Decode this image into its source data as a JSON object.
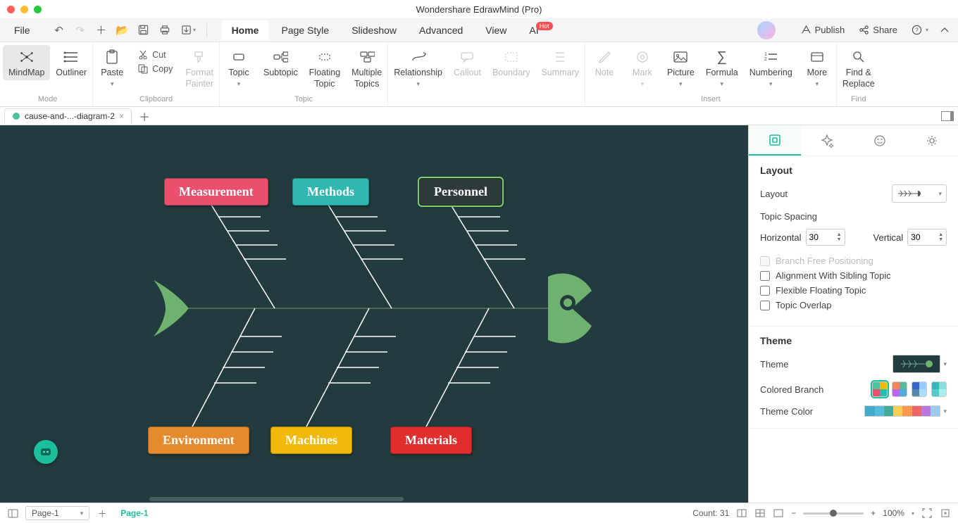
{
  "app_title": "Wondershare EdrawMind (Pro)",
  "menubar": {
    "file": "File",
    "tabs": [
      "Home",
      "Page Style",
      "Slideshow",
      "Advanced",
      "View",
      "AI"
    ],
    "active_tab": "Home",
    "hot": "Hot",
    "publish": "Publish",
    "share": "Share"
  },
  "ribbon": {
    "mode_label": "Mode",
    "mindmap": "MindMap",
    "outliner": "Outliner",
    "clipboard_label": "Clipboard",
    "paste": "Paste",
    "cut": "Cut",
    "copy": "Copy",
    "format_painter": "Format\nPainter",
    "topic_label": "Topic",
    "topic": "Topic",
    "subtopic": "Subtopic",
    "floating": "Floating\nTopic",
    "multiple": "Multiple\nTopics",
    "relationship": "Relationship",
    "callout": "Callout",
    "boundary": "Boundary",
    "summary": "Summary",
    "insert_label": "Insert",
    "note": "Note",
    "mark": "Mark",
    "picture": "Picture",
    "formula": "Formula",
    "numbering": "Numbering",
    "more": "More",
    "find_label": "Find",
    "find_replace": "Find &\nReplace"
  },
  "document": {
    "tab_name": "cause-and-...-diagram-2"
  },
  "fish": {
    "top": [
      "Measurement",
      "Methods",
      "Personnel"
    ],
    "bottom": [
      "Environment",
      "Machines",
      "Materials"
    ],
    "colors_top": [
      "#e8506e",
      "#2fb7b0",
      "#2e3a3a"
    ],
    "colors_bottom": [
      "#e68a2e",
      "#f2b90d",
      "#e02d2d"
    ],
    "selected": "Personnel"
  },
  "panel": {
    "layout_title": "Layout",
    "layout_label": "Layout",
    "topic_spacing": "Topic Spacing",
    "horizontal": "Horizontal",
    "vertical": "Vertical",
    "h_val": "30",
    "v_val": "30",
    "branch_free": "Branch Free Positioning",
    "align_sibling": "Alignment With Sibling Topic",
    "flex_float": "Flexible Floating Topic",
    "overlap": "Topic Overlap",
    "theme_title": "Theme",
    "theme_label": "Theme",
    "colored_branch": "Colored Branch",
    "theme_color": "Theme Color"
  },
  "status": {
    "page_sel": "Page-1",
    "page_chip": "Page-1",
    "count": "Count: 31",
    "zoom": "100%"
  }
}
